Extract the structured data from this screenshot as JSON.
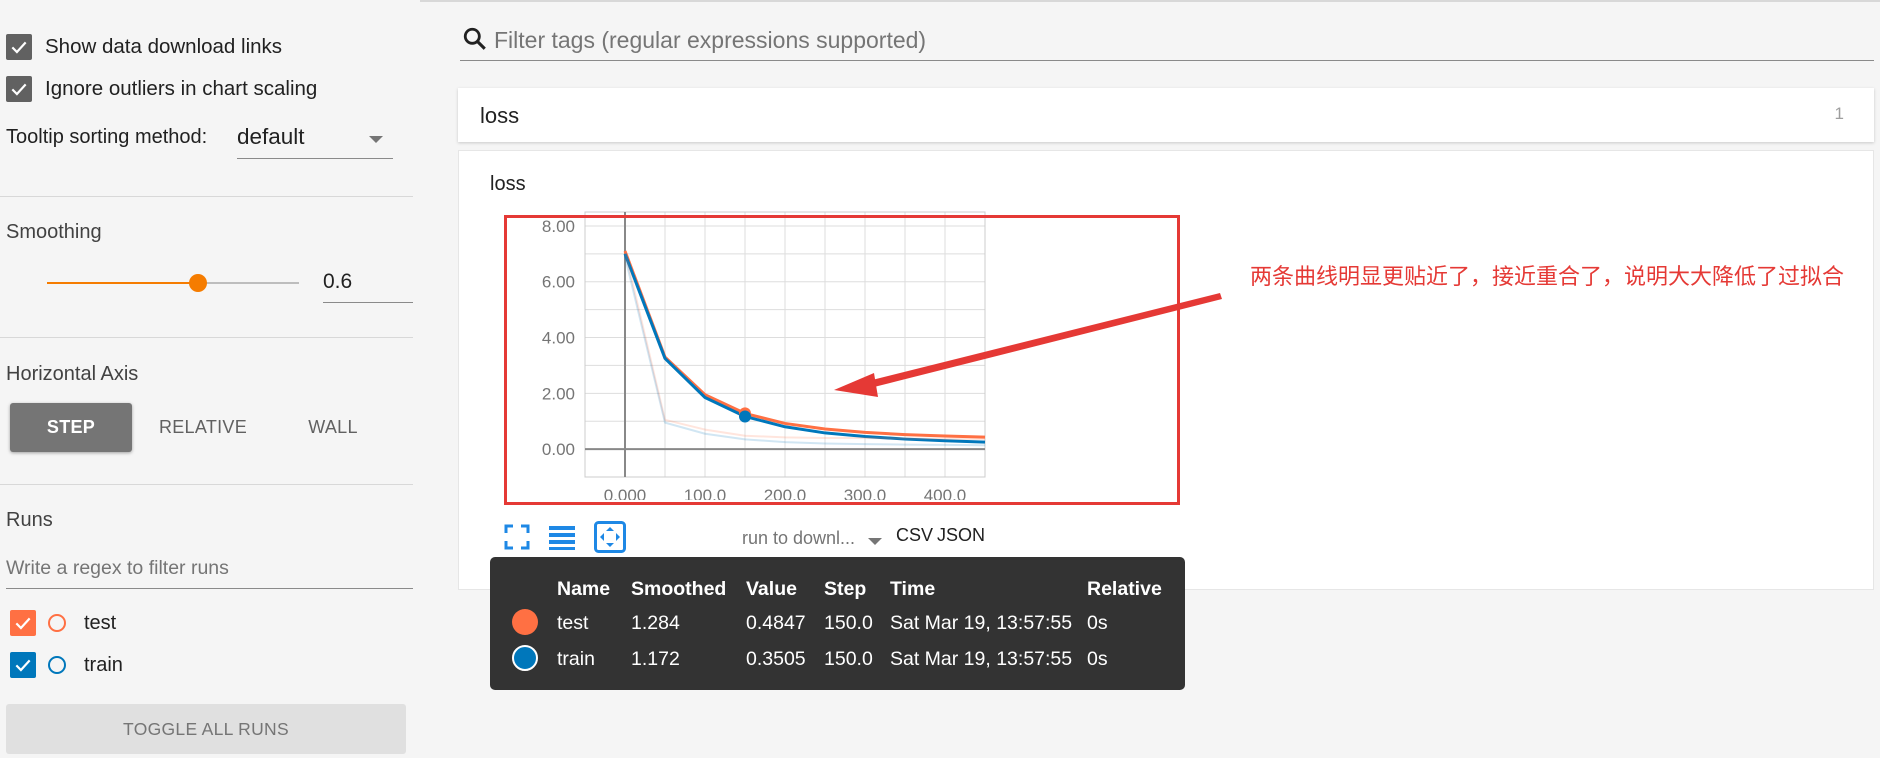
{
  "sidebar": {
    "show_download_label": "Show data download links",
    "ignore_outliers_label": "Ignore outliers in chart scaling",
    "tooltip_sorting_label": "Tooltip sorting method:",
    "tooltip_sorting_value": "default",
    "smoothing_title": "Smoothing",
    "smoothing_value": "0.6",
    "smoothing_fraction": 0.6,
    "horizontal_axis_title": "Horizontal Axis",
    "axis_options": [
      "STEP",
      "RELATIVE",
      "WALL"
    ],
    "axis_selected": "STEP",
    "runs_title": "Runs",
    "runs_filter_placeholder": "Write a regex to filter runs",
    "runs": [
      {
        "name": "test",
        "color": "#ff7043",
        "checked": true
      },
      {
        "name": "train",
        "color": "#0077bb",
        "checked": true
      }
    ],
    "toggle_all_label": "TOGGLE ALL RUNS"
  },
  "main": {
    "search_placeholder": "Filter tags (regular expressions supported)",
    "card_title": "loss",
    "card_count": "1",
    "chart_title": "loss",
    "annotation": "两条曲线明显更贴近了，接近重合了，说明大大降低了过拟合",
    "download_select": "run to downl...",
    "download_links": [
      "CSV",
      "JSON"
    ]
  },
  "tooltip": {
    "headers": [
      "Name",
      "Smoothed",
      "Value",
      "Step",
      "Time",
      "Relative"
    ],
    "rows": [
      {
        "name": "test",
        "smoothed": "1.284",
        "value": "0.4847",
        "step": "150.0",
        "time": "Sat Mar 19, 13:57:55",
        "relative": "0s",
        "color": "#ff7043"
      },
      {
        "name": "train",
        "smoothed": "1.172",
        "value": "0.3505",
        "step": "150.0",
        "time": "Sat Mar 19, 13:57:55",
        "relative": "0s",
        "color": "#0077bb"
      }
    ]
  },
  "chart_data": {
    "type": "line",
    "title": "loss",
    "xlabel": "",
    "ylabel": "",
    "x_ticks": [
      "0.000",
      "100.0",
      "200.0",
      "300.0",
      "400.0"
    ],
    "y_ticks": [
      "0.00",
      "2.00",
      "4.00",
      "6.00",
      "8.00"
    ],
    "xlim": [
      -50,
      450
    ],
    "ylim": [
      -1,
      8.5
    ],
    "grid": true,
    "series": [
      {
        "name": "test",
        "color": "#ff7043",
        "x": [
          0,
          50,
          100,
          150,
          200,
          250,
          300,
          350,
          400,
          450
        ],
        "y": [
          7.1,
          3.3,
          1.95,
          1.28,
          0.92,
          0.72,
          0.6,
          0.52,
          0.47,
          0.43
        ]
      },
      {
        "name": "train",
        "color": "#0077bb",
        "x": [
          0,
          50,
          100,
          150,
          200,
          250,
          300,
          350,
          400,
          450
        ],
        "y": [
          7.0,
          3.25,
          1.85,
          1.17,
          0.8,
          0.58,
          0.45,
          0.36,
          0.3,
          0.25
        ]
      },
      {
        "name": "test",
        "raw": true,
        "color": "#ff7043",
        "x": [
          0,
          50,
          100,
          150,
          200,
          250,
          300,
          350,
          400,
          450
        ],
        "y": [
          7.1,
          1.05,
          0.7,
          0.48,
          0.42,
          0.4,
          0.4,
          0.38,
          0.37,
          0.36
        ]
      },
      {
        "name": "train",
        "raw": true,
        "color": "#0077bb",
        "x": [
          0,
          50,
          100,
          150,
          200,
          250,
          300,
          350,
          400,
          450
        ],
        "y": [
          6.9,
          0.95,
          0.55,
          0.35,
          0.25,
          0.2,
          0.18,
          0.16,
          0.15,
          0.14
        ]
      }
    ],
    "highlight_x": 150
  }
}
